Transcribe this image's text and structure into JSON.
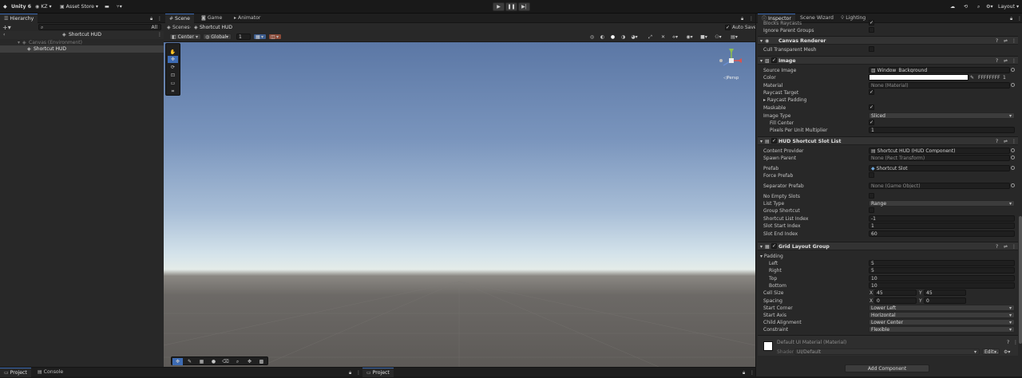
{
  "topbar": {
    "product": "Unity 6",
    "account": "KZ",
    "asset_store": "Asset Store",
    "layout": "Layout"
  },
  "hierarchy": {
    "tab": "Hierarchy",
    "search_placeholder": "All",
    "scene": "Shortcut HUD",
    "canvas": "Canvas (Environment)",
    "child": "Shortcut HUD"
  },
  "scene_tabs": {
    "scene": "Scene",
    "game": "Game",
    "animator": "Animator"
  },
  "breadcrumb": {
    "root": "Scenes",
    "current": "Shortcut HUD"
  },
  "scene_toolbar": {
    "pivot": "Center",
    "space": "Global",
    "snap": "1",
    "auto_save": "Auto Save",
    "persp": "◁Persp"
  },
  "inspector": {
    "tabs": [
      "Inspector",
      "Scene Wizard",
      "Lighting"
    ],
    "prev": {
      "blocks": "Blocks Raycasts",
      "ignore": "Ignore Parent Groups"
    },
    "canvas_renderer": {
      "title": "Canvas Renderer",
      "cull": "Cull Transparent Mesh"
    },
    "image": {
      "title": "Image",
      "rows": [
        "Source Image",
        "Color",
        "Material",
        "Raycast Target",
        "Raycast Padding",
        "Maskable",
        "Image Type",
        "Fill Center",
        "Pixels Per Unit Multiplier"
      ],
      "source": "Window_Background",
      "hex": "FFFFFFFF",
      "alpha": "1",
      "material": "None (Material)",
      "type": "Sliced",
      "ppu": "1"
    },
    "slot_list": {
      "title": "HUD Shortcut Slot List",
      "rows": [
        "Content Provider",
        "Spawn Parent",
        "Prefab",
        "Force Prefab",
        "Separator Prefab",
        "No Empty Slots",
        "List Type",
        "Group Shortcut",
        "Shortcut List Index",
        "Slot Start Index",
        "Slot End Index"
      ],
      "provider": "Shortcut HUD (HUD Component)",
      "spawn": "None (Rect Transform)",
      "prefab": "Shortcut Slot",
      "separator": "None (Game Object)",
      "list_type": "Range",
      "list_index": "-1",
      "start": "1",
      "end": "60"
    },
    "grid": {
      "title": "Grid Layout Group",
      "padding": "Padding",
      "pad_rows": [
        "Left",
        "Right",
        "Top",
        "Bottom"
      ],
      "pad_vals": [
        "5",
        "5",
        "10",
        "10"
      ],
      "cell": "Cell Size",
      "spacing": "Spacing",
      "x": "X",
      "y": "Y",
      "cell_x": "45",
      "cell_y": "45",
      "sp_x": "0",
      "sp_y": "0",
      "rows": [
        "Start Corner",
        "Start Axis",
        "Child Alignment",
        "Constraint"
      ],
      "vals": [
        "Lower Left",
        "Horizontal",
        "Lower Center",
        "Flexible"
      ]
    },
    "material": {
      "title": "Default UI Material (Material)",
      "shader_label": "Shader",
      "shader": "UI/Default",
      "edit": "Edit..."
    },
    "add_component": "Add Component"
  },
  "bottom": {
    "project": "Project",
    "console": "Console",
    "project2": "Project"
  },
  "colors": {
    "accent": "#3d6bb3",
    "panel": "#282828"
  }
}
